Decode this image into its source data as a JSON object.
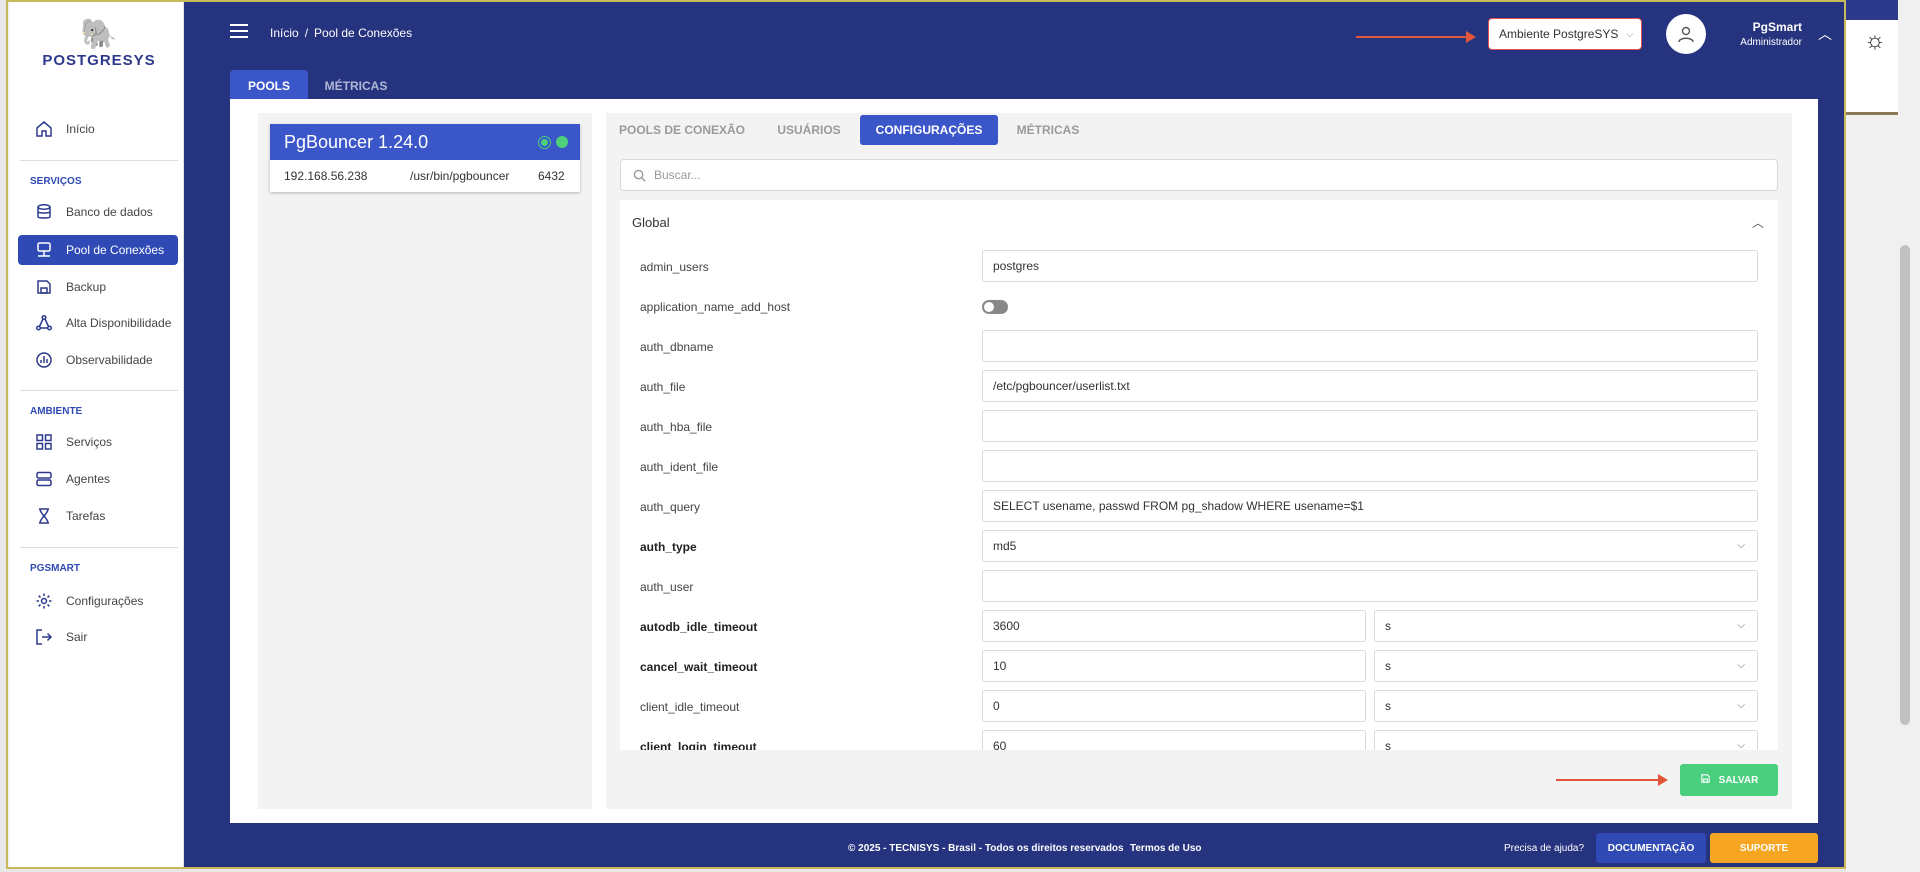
{
  "app": {
    "logo_text": "POSTGRESYS"
  },
  "sidebar": {
    "items_top": [
      {
        "label": "Início",
        "icon": "home-icon"
      }
    ],
    "sections": [
      {
        "title": "SERVIÇOS",
        "items": [
          {
            "label": "Banco de dados",
            "icon": "database-icon"
          },
          {
            "label": "Pool de Conexões",
            "icon": "server-network-icon",
            "active": true
          },
          {
            "label": "Backup",
            "icon": "save-icon"
          },
          {
            "label": "Alta Disponibilidade",
            "icon": "nodes-icon"
          },
          {
            "label": "Observabilidade",
            "icon": "chart-circle-icon"
          }
        ]
      },
      {
        "title": "AMBIENTE",
        "items": [
          {
            "label": "Serviços",
            "icon": "grid-icon"
          },
          {
            "label": "Agentes",
            "icon": "servers-icon"
          },
          {
            "label": "Tarefas",
            "icon": "hourglass-icon"
          }
        ]
      },
      {
        "title": "PGSMART",
        "items": [
          {
            "label": "Configurações",
            "icon": "gear-icon"
          },
          {
            "label": "Sair",
            "icon": "logout-icon"
          }
        ]
      }
    ]
  },
  "header": {
    "breadcrumb": [
      "Início",
      "Pool de Conexões"
    ],
    "breadcrumb_sep": "/",
    "environment": "Ambiente PostgreSYS",
    "user_name": "PgSmart",
    "user_role": "Administrador",
    "tabs": [
      {
        "label": "POOLS",
        "active": true
      },
      {
        "label": "MÉTRICAS",
        "active": false
      }
    ]
  },
  "pool": {
    "title": "PgBouncer 1.24.0",
    "ip": "192.168.56.238",
    "path": "/usr/bin/pgbouncer",
    "port": "6432",
    "status_color": "#4cd07c"
  },
  "subtabs": [
    {
      "label": "POOLS DE CONEXÃO",
      "active": false
    },
    {
      "label": "USUÁRIOS",
      "active": false
    },
    {
      "label": "CONFIGURAÇÕES",
      "active": true
    },
    {
      "label": "MÉTRICAS",
      "active": false
    }
  ],
  "search": {
    "placeholder": "Buscar...",
    "value": ""
  },
  "config": {
    "section_title": "Global",
    "rows": [
      {
        "key": "admin_users",
        "bold": false,
        "type": "text",
        "value": "postgres"
      },
      {
        "key": "application_name_add_host",
        "bold": false,
        "type": "toggle",
        "value": "off"
      },
      {
        "key": "auth_dbname",
        "bold": false,
        "type": "text",
        "value": ""
      },
      {
        "key": "auth_file",
        "bold": false,
        "type": "text",
        "value": "/etc/pgbouncer/userlist.txt"
      },
      {
        "key": "auth_hba_file",
        "bold": false,
        "type": "text",
        "value": ""
      },
      {
        "key": "auth_ident_file",
        "bold": false,
        "type": "text",
        "value": ""
      },
      {
        "key": "auth_query",
        "bold": false,
        "type": "text",
        "value": "SELECT usename, passwd FROM pg_shadow WHERE usename=$1"
      },
      {
        "key": "auth_type",
        "bold": true,
        "type": "select",
        "value": "md5"
      },
      {
        "key": "auth_user",
        "bold": false,
        "type": "text",
        "value": ""
      },
      {
        "key": "autodb_idle_timeout",
        "bold": true,
        "type": "unit",
        "value": "3600",
        "unit": "s"
      },
      {
        "key": "cancel_wait_timeout",
        "bold": true,
        "type": "unit",
        "value": "10",
        "unit": "s"
      },
      {
        "key": "client_idle_timeout",
        "bold": false,
        "type": "unit",
        "value": "0",
        "unit": "s"
      },
      {
        "key": "client_login_timeout",
        "bold": true,
        "type": "unit",
        "value": "60",
        "unit": "s"
      }
    ]
  },
  "actions": {
    "save_label": "SALVAR"
  },
  "footer": {
    "copyright": "© 2025 - TECNISYS - Brasil - Todos os direitos reservados",
    "terms": "Termos de Uso",
    "help": "Precisa de ajuda?",
    "doc_label": "DOCUMENTAÇÃO",
    "support_label": "SUPORTE"
  },
  "colors": {
    "primary": "#26337f",
    "accent": "#3a56c8",
    "success": "#49cf7d",
    "warning": "#f6a623",
    "annotation_arrow": "#e2573c"
  }
}
